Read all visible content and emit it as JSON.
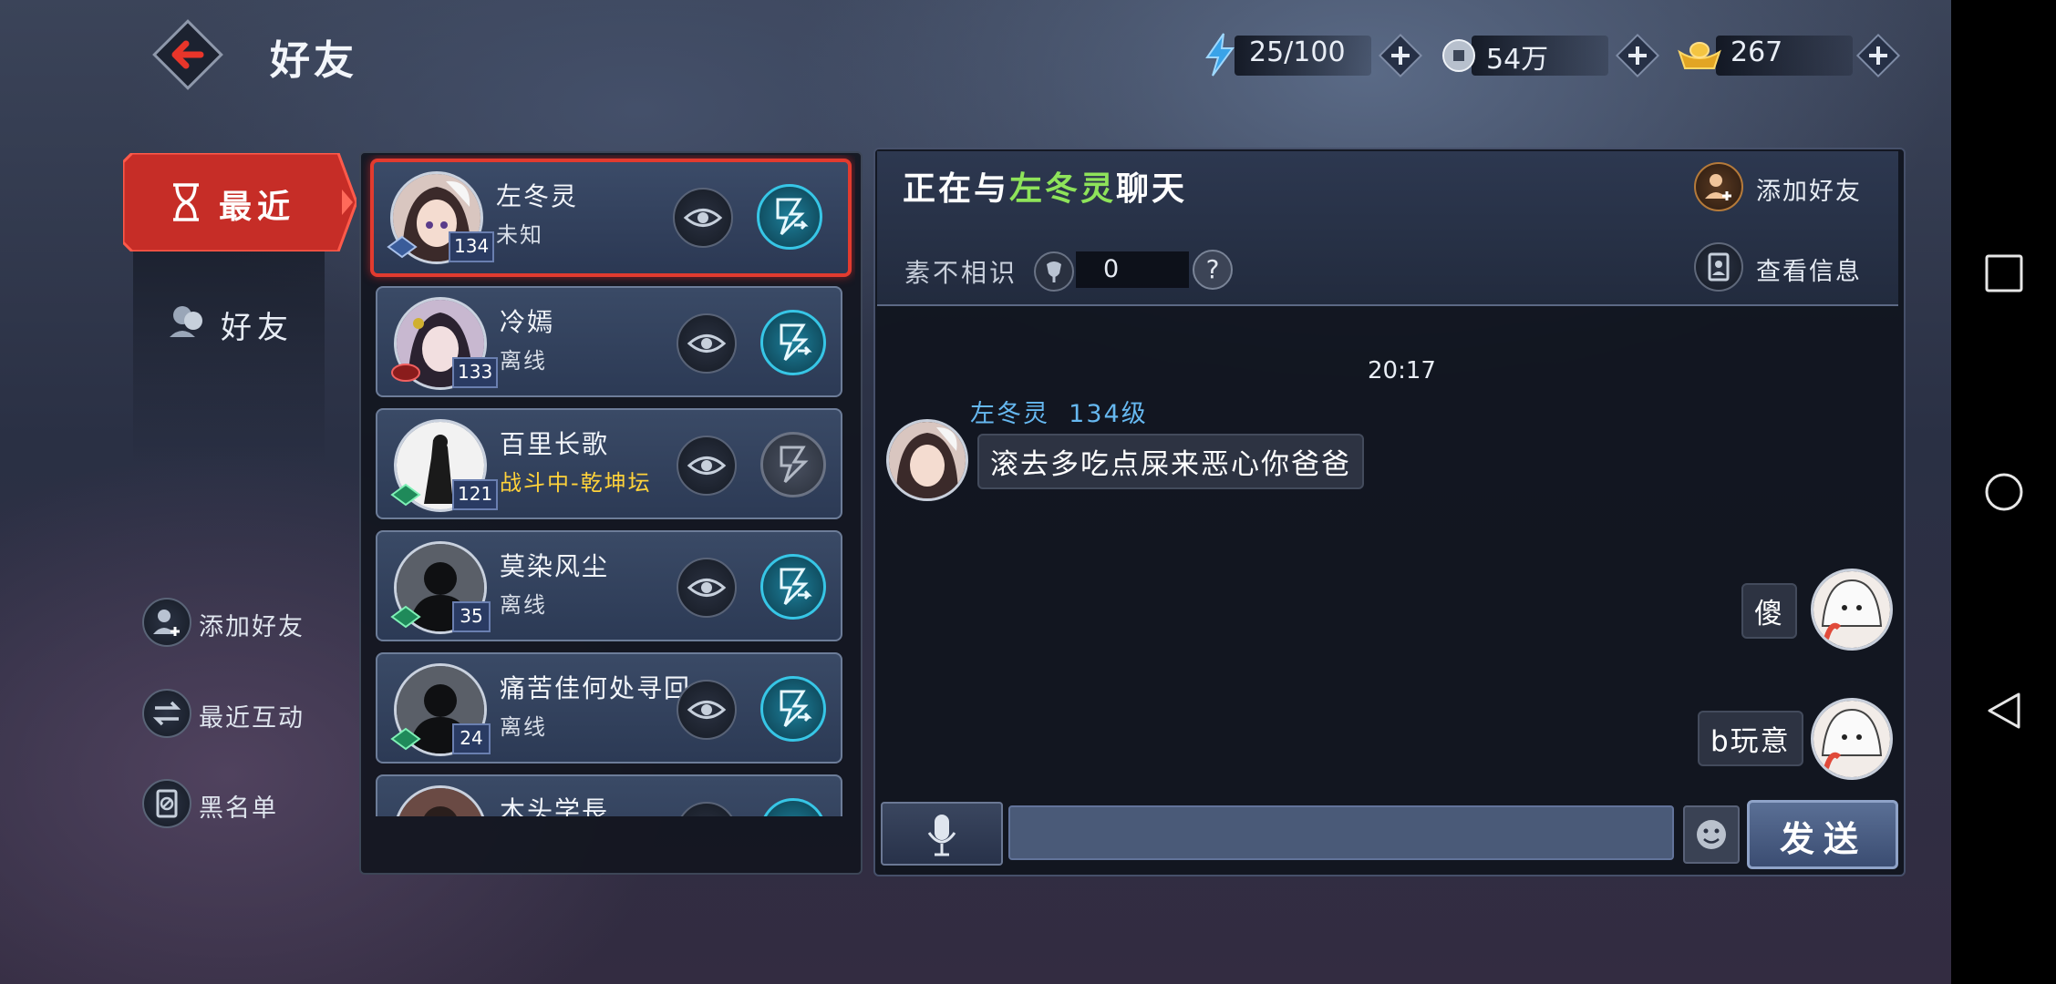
{
  "header": {
    "title": "好友",
    "resources": [
      {
        "name": "stamina",
        "icon": "lightning-icon",
        "value": "25/100"
      },
      {
        "name": "coins",
        "icon": "coin-icon",
        "value": "54万"
      },
      {
        "name": "ingots",
        "icon": "gold-ingot-icon",
        "value": "267"
      }
    ]
  },
  "sidebar": {
    "tabs": [
      {
        "label": "最近",
        "icon": "hourglass-icon",
        "active": true
      },
      {
        "label": "好友",
        "icon": "friends-icon",
        "active": false
      }
    ],
    "actions": [
      {
        "label": "添加好友",
        "icon": "add-friend-icon"
      },
      {
        "label": "最近互动",
        "icon": "swap-arrows-icon"
      },
      {
        "label": "黑名单",
        "icon": "blacklist-icon"
      }
    ]
  },
  "friends": [
    {
      "name": "左冬灵",
      "status": "未知",
      "level": "134",
      "selected": true,
      "chat_enabled": true
    },
    {
      "name": "冷嫣",
      "status": "离线",
      "level": "133",
      "selected": false,
      "chat_enabled": true
    },
    {
      "name": "百里长歌",
      "status": "战斗中-乾坤坛",
      "level": "121",
      "selected": false,
      "chat_enabled": false
    },
    {
      "name": "莫染风尘",
      "status": "离线",
      "level": "35",
      "selected": false,
      "chat_enabled": true
    },
    {
      "name": "痛苦佳何处寻回",
      "status": "离线",
      "level": "24",
      "selected": false,
      "chat_enabled": true
    },
    {
      "name": "木头学長",
      "status": "",
      "level": "",
      "selected": false,
      "chat_enabled": true
    }
  ],
  "chat": {
    "title_prefix": "正在与",
    "title_name": "左冬灵",
    "title_suffix": "聊天",
    "relation_label": "素不相识",
    "relation_value": "0",
    "help": "?",
    "add_friend": "添加好友",
    "view_info": "查看信息",
    "time": "20:17",
    "sender_name": "左冬灵",
    "sender_level": "134级",
    "messages": [
      {
        "from": "other",
        "text": "滚去多吃点屎来恶心你爸爸"
      },
      {
        "from": "self",
        "text": "傻"
      },
      {
        "from": "self",
        "text": "b玩意"
      }
    ],
    "input_value": "",
    "send_label": "发送"
  },
  "colors": {
    "accent_red": "#e23b2f",
    "highlight_green": "#8ee35a",
    "sender_blue": "#66b8f0",
    "status_fighting": "#ffd23a",
    "chat_button_cyan": "#37c6e6"
  }
}
